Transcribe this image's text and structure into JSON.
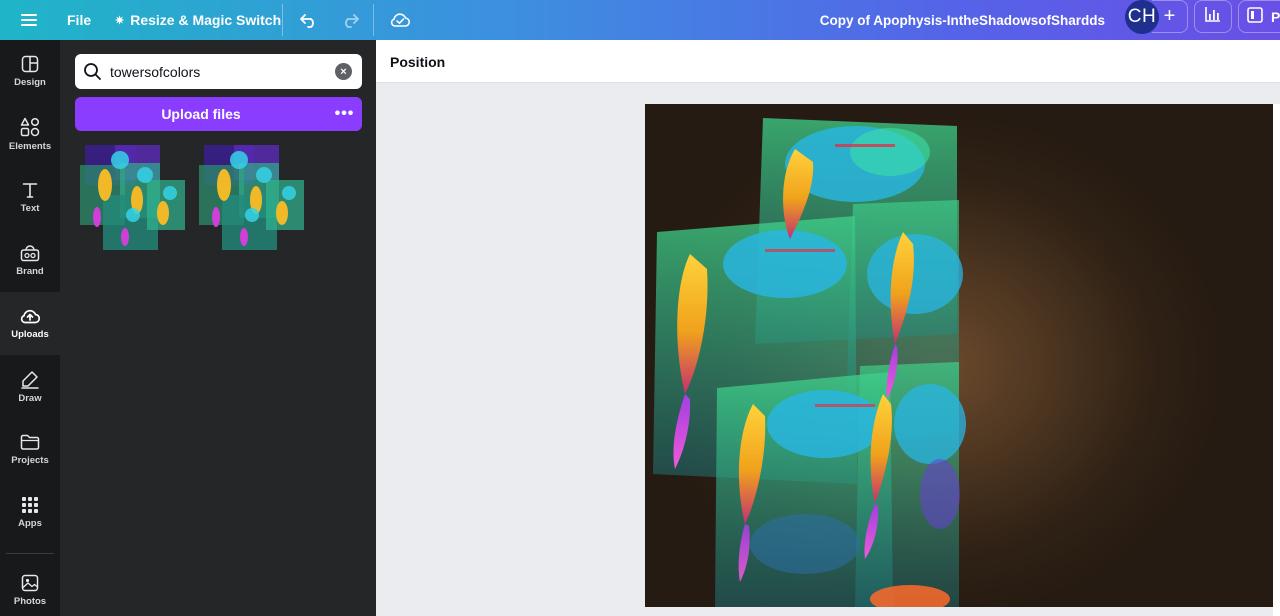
{
  "topbar": {
    "file_label": "File",
    "resize_label": "Resize & Magic Switch",
    "doc_title": "Copy of Apophysis-IntheShadowsofShardds",
    "avatar_initials": "CH",
    "plus_label": "+",
    "present_label": "P"
  },
  "rail": {
    "items": [
      {
        "label": "Design",
        "icon": "design-icon"
      },
      {
        "label": "Elements",
        "icon": "elements-icon"
      },
      {
        "label": "Text",
        "icon": "text-icon"
      },
      {
        "label": "Brand",
        "icon": "brand-icon"
      },
      {
        "label": "Uploads",
        "icon": "uploads-icon"
      },
      {
        "label": "Draw",
        "icon": "draw-icon"
      },
      {
        "label": "Projects",
        "icon": "projects-icon"
      },
      {
        "label": "Apps",
        "icon": "apps-icon"
      },
      {
        "label": "Photos",
        "icon": "photos-icon"
      }
    ],
    "active": "Uploads"
  },
  "panel": {
    "search_value": "towersofcolors",
    "upload_label": "Upload files",
    "more_label": "•••"
  },
  "context_bar": {
    "position_label": "Position"
  },
  "colors": {
    "accent": "#8b3dff",
    "rail_bg": "#18191b",
    "panel_bg": "#252627",
    "avatar_bg": "#1e2f8e"
  }
}
